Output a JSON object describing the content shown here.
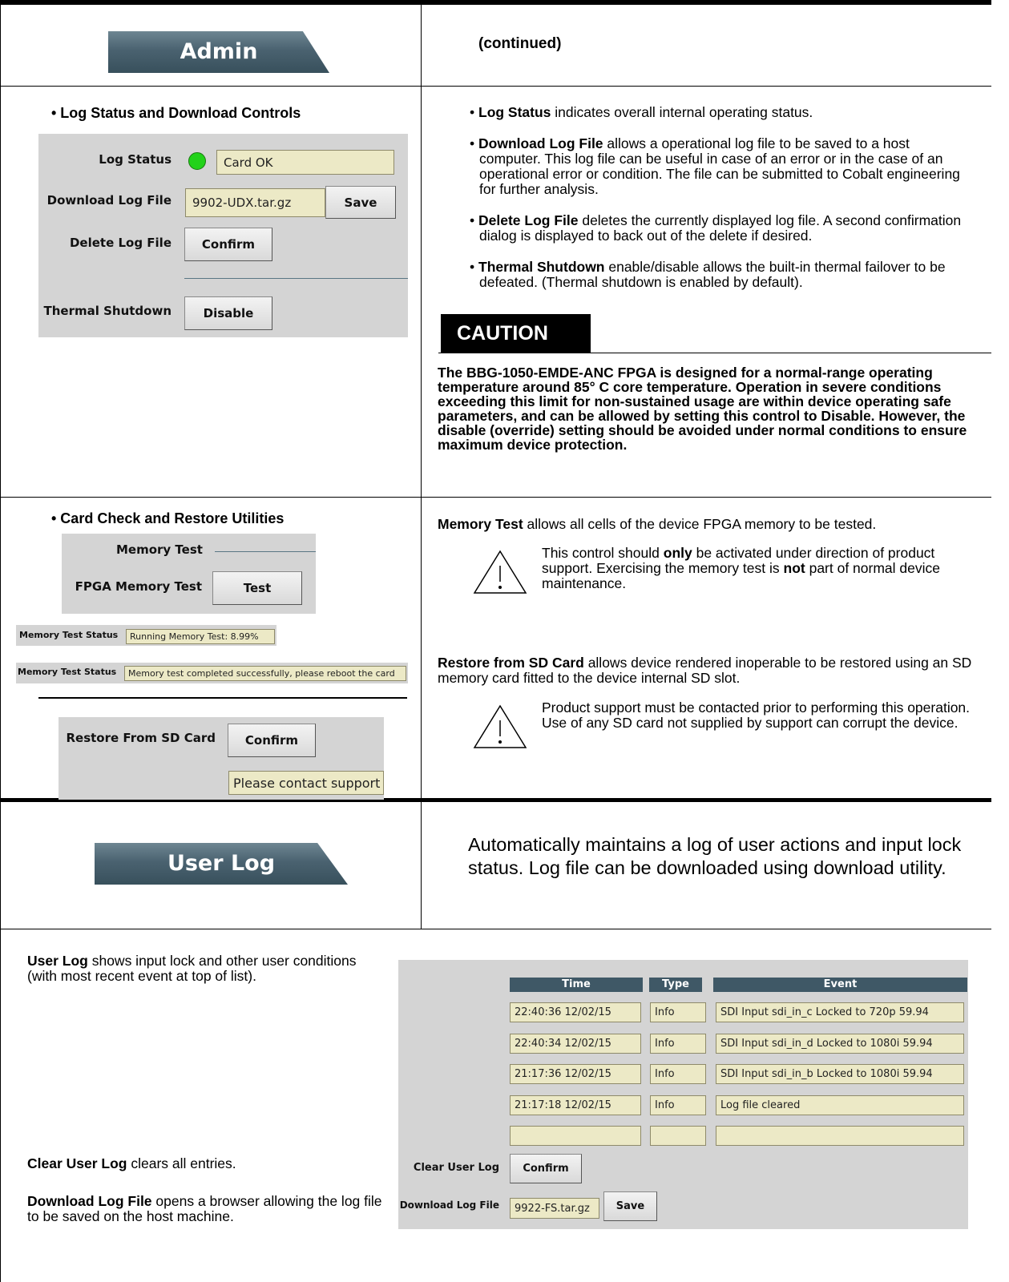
{
  "admin_tab": {
    "label": "Admin"
  },
  "continued": "(continued)",
  "log_section": {
    "heading": "• Log Status and Download Controls",
    "log_status_label": "Log Status",
    "log_status_value": "Card OK",
    "download_label": "Download Log File",
    "download_value": "9902-UDX.tar.gz",
    "save_label": "Save",
    "delete_label": "Delete Log File",
    "confirm_label": "Confirm",
    "thermal_label": "Thermal Shutdown",
    "disable_label": "Disable"
  },
  "log_desc": {
    "p1_bold": "Log Status",
    "p1_rest": " indicates overall internal operating status.",
    "p2_bold": "Download Log File",
    "p2_rest": " allows a operational log file to be saved to a host computer. This log file can be useful in case of an error or in the case of an operational error or condition. The file can be submitted to Cobalt engineering for further analysis.",
    "p3_bold": "Delete Log File",
    "p3_rest": " deletes the currently displayed log file. A second confirmation dialog is displayed to back out of the delete if desired.",
    "p4_bold": "Thermal Shutdown",
    "p4_rest": " enable/disable allows the built-in thermal failover to be defeated. (Thermal shutdown is enabled by default).",
    "caution_label": "CAUTION",
    "caution_text": "The BBG-1050-EMDE-ANC FPGA is designed for a normal-range operating temperature around 85° C core temperature. Operation in severe conditions exceeding this limit for non-sustained usage are within device operating safe parameters, and can be allowed by setting this control to Disable. However, the disable (override) setting should be avoided under normal conditions to ensure maximum device protection."
  },
  "card_section": {
    "heading": "• Card Check and Restore Utilities",
    "memory_test_group": "Memory Test",
    "fpga_label": "FPGA Memory Test",
    "test_label": "Test",
    "status_label": "Memory Test Status",
    "status_running": "Running Memory Test: 8.99%",
    "status_done": "Memory test completed successfully, please reboot the card",
    "restore_label": "Restore From SD Card",
    "confirm_label": "Confirm",
    "restore_status": "Please contact support"
  },
  "card_desc": {
    "mem_bold": "Memory Test",
    "mem_rest": " allows all cells of the device FPGA memory to be tested.",
    "mem_note_a": "This control should ",
    "mem_note_only": "only",
    "mem_note_b": " be activated under direction of product support. Exercising the memory test is ",
    "mem_note_not": "not",
    "mem_note_c": " part of normal device maintenance.",
    "restore_bold": "Restore from SD Card",
    "restore_rest": " allows device rendered inoperable to be restored using an SD memory card fitted to the device internal SD slot.",
    "restore_note": "Product support must be contacted prior to performing this operation. Use of any SD card not supplied by support can corrupt the device."
  },
  "user_log_tab": {
    "label": "User Log"
  },
  "user_log_summary": "Automatically maintains a log of user actions and input lock status. Log file can be downloaded using download utility.",
  "user_log_desc": {
    "p1_bold": "User Log",
    "p1_rest": " shows input lock and other user conditions (with most recent event at top of list).",
    "p2_bold": "Clear User Log",
    "p2_rest": " clears all entries.",
    "p3_bold": "Download Log File",
    "p3_rest": " opens a browser allowing the log file to be saved on the host machine."
  },
  "user_log_table": {
    "headers": [
      "Time",
      "Type",
      "Event"
    ],
    "rows": [
      [
        "22:40:36 12/02/15",
        "Info",
        "SDI Input sdi_in_c Locked to 720p 59.94"
      ],
      [
        "22:40:34 12/02/15",
        "Info",
        "SDI Input sdi_in_d Locked to 1080i 59.94"
      ],
      [
        "21:17:36 12/02/15",
        "Info",
        "SDI Input sdi_in_b Locked to 1080i 59.94"
      ],
      [
        "21:17:18 12/02/15",
        "Info",
        "Log file cleared"
      ],
      [
        "",
        "",
        ""
      ]
    ],
    "clear_label": "Clear User Log",
    "confirm_label": "Confirm",
    "download_label": "Download Log File",
    "download_value": "9922-FS.tar.gz",
    "save_label": "Save"
  },
  "colors": {
    "led_ok": "#22d21a",
    "field_bg": "#ece9c6",
    "panel_bg": "#d4d4d4",
    "tab_bg": "#4a6270"
  }
}
